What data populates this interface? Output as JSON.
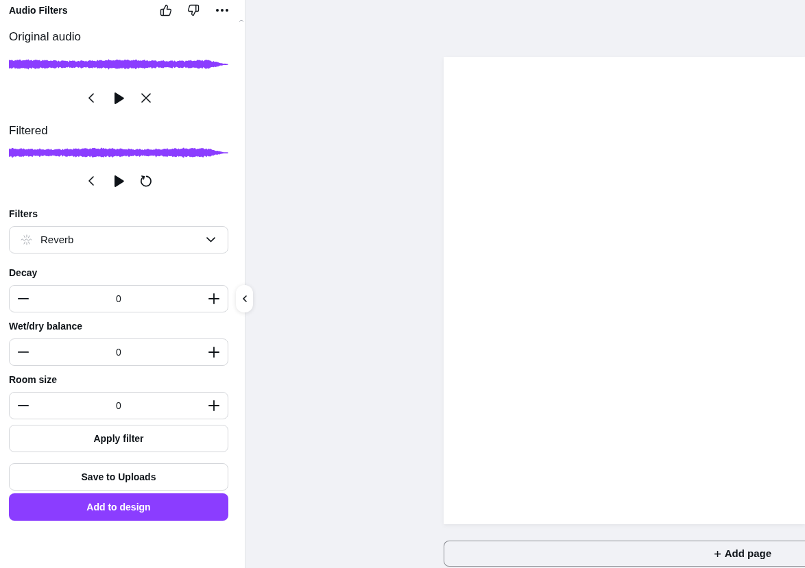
{
  "panel": {
    "title": "Audio Filters"
  },
  "players": [
    {
      "kind": "original",
      "title": "Original audio"
    },
    {
      "kind": "filtered",
      "title": "Filtered"
    }
  ],
  "filter": {
    "label": "Filters",
    "value": "Reverb",
    "apply_button": "Apply filter"
  },
  "parameters": [
    {
      "label": "Decay",
      "value": "0"
    },
    {
      "label": "Wet/dry balance",
      "value": "0"
    },
    {
      "label": "Room size",
      "value": "0"
    }
  ],
  "actions": [
    {
      "kind": "secondary",
      "label": "Save to Uploads"
    },
    {
      "kind": "primary",
      "label": "Add to design"
    }
  ],
  "canvas": {
    "add_page": "Add page"
  }
}
